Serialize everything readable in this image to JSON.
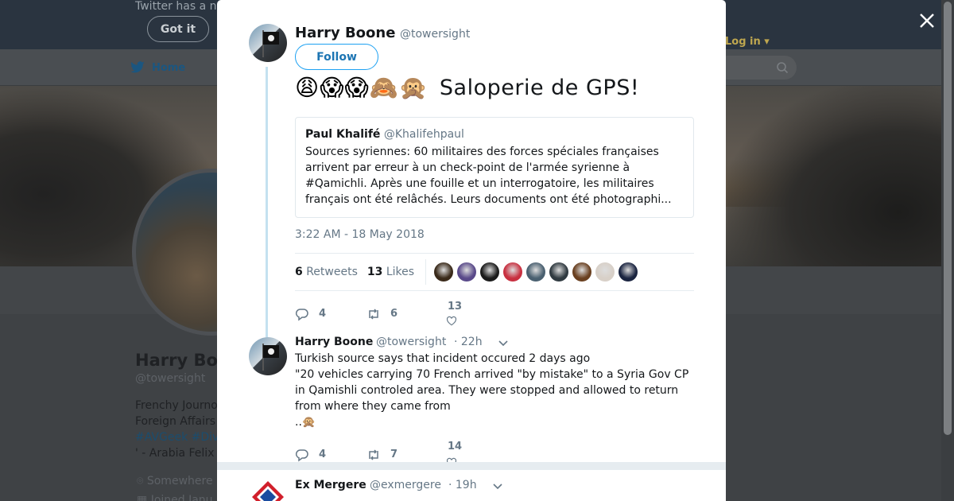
{
  "background": {
    "banner_text": "Twitter has a n",
    "got_it_label": "Got it",
    "nav_home_label": "Home",
    "login_label": "Log in",
    "profile_name": "Harry Bo",
    "profile_handle": "@towersight",
    "bio_line1": "Frenchy Journo",
    "bio_line2": "Foreign Affairs",
    "bio_tags": "#AVGeek #Div",
    "bio_line4": "' - Arabia Felix",
    "location": "Somewhere",
    "joined": "Joined Janu"
  },
  "main_tweet": {
    "author_name": "Harry Boone",
    "author_handle": "@towersight",
    "follow_label": "Follow",
    "emojis": "😩😱😱🙈🙊",
    "text": "Saloperie de GPS!",
    "quote": {
      "author_name": "Paul Khalifé",
      "author_handle": "@Khalifehpaul",
      "text": "Sources syriennes: 60 militaires des forces spéciales françaises arrivent par erreur à un check-point de l'armée syrienne à #Qamichli. Après une fouille et un interrogatoire, les militaires français ont été relâchés. Leurs documents ont été photographi..."
    },
    "timestamp": "3:22 AM - 18 May 2018",
    "retweets_count": "6",
    "retweets_label": "Retweets",
    "likes_count": "13",
    "likes_label": "Likes",
    "likers": [
      "#3a2a1a",
      "#5a4a8a",
      "#1a1a1a",
      "#c83040",
      "#4a6070",
      "#303a40",
      "#6a4020",
      "#d8d0c8",
      "#1a2440"
    ],
    "actions": {
      "replies": "4",
      "retweets": "6",
      "likes": "13"
    }
  },
  "reply_tweet": {
    "author_name": "Harry Boone",
    "author_handle": "@towersight",
    "time": "· 22h",
    "text": "Turkish source says that incident occured 2 days ago\n\"20 vehicles carrying 70 French  arrived \"by mistake\" to a Syria Gov CP in Qamishli controled area. They  were stopped and allowed to return from where they came from\n..🙊",
    "actions": {
      "replies": "4",
      "retweets": "7",
      "likes": "14"
    }
  },
  "next_tweet": {
    "author_name": "Ex Mergere",
    "author_handle": "@exmergere",
    "time": "· 19h"
  },
  "colors": {
    "accent": "#1da1f2",
    "thread_line": "#c4e1f0",
    "muted": "#657786"
  }
}
